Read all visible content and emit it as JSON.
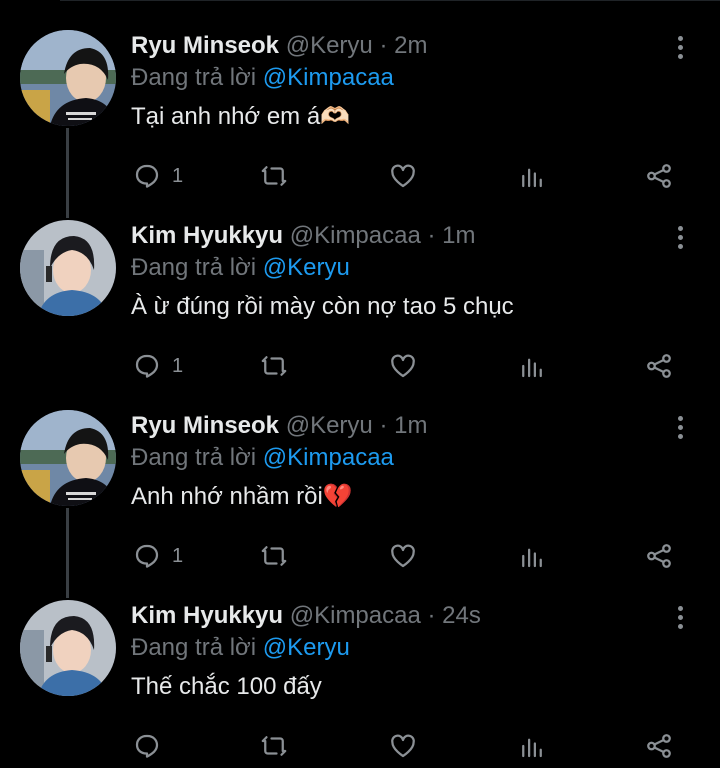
{
  "tweets": [
    {
      "name": "Ryu Minseok",
      "handle": "@Keryu",
      "dot": "·",
      "time": "2m",
      "reply_prefix": "Đang trả lời",
      "reply_to": "@Kimpacaa",
      "text": "Tại anh nhớ em á🫶🏻",
      "reply_count": "1",
      "avatar_icon": "avatar-minseok",
      "actions": [
        "reply-icon",
        "retweet-icon",
        "like-icon",
        "analytics-icon",
        "share-icon"
      ]
    },
    {
      "name": "Kim Hyukkyu",
      "handle": "@Kimpacaa",
      "dot": "·",
      "time": "1m",
      "reply_prefix": "Đang trả lời",
      "reply_to": "@Keryu",
      "text": "À ừ đúng rồi mày còn nợ tao 5 chục",
      "reply_count": "1",
      "avatar_icon": "avatar-hyukkyu",
      "actions": [
        "reply-icon",
        "retweet-icon",
        "like-icon",
        "analytics-icon",
        "share-icon"
      ]
    },
    {
      "name": "Ryu Minseok",
      "handle": "@Keryu",
      "dot": "·",
      "time": "1m",
      "reply_prefix": "Đang trả lời",
      "reply_to": "@Kimpacaa",
      "text": "Anh nhớ nhầm rồi💔",
      "reply_count": "1",
      "avatar_icon": "avatar-minseok",
      "actions": [
        "reply-icon",
        "retweet-icon",
        "like-icon",
        "analytics-icon",
        "share-icon"
      ]
    },
    {
      "name": "Kim Hyukkyu",
      "handle": "@Kimpacaa",
      "dot": "·",
      "time": "24s",
      "reply_prefix": "Đang trả lời",
      "reply_to": "@Keryu",
      "text": "Thế chắc 100 đấy",
      "reply_count": "",
      "avatar_icon": "avatar-hyukkyu",
      "actions": [
        "reply-icon",
        "retweet-icon",
        "like-icon",
        "analytics-icon",
        "share-icon"
      ]
    }
  ],
  "colors": {
    "background": "#000000",
    "text": "#e7e9ea",
    "muted": "#71767b",
    "accent": "#1d9bf0",
    "icon": "#8b9095",
    "thread_line": "#3a3f44"
  }
}
